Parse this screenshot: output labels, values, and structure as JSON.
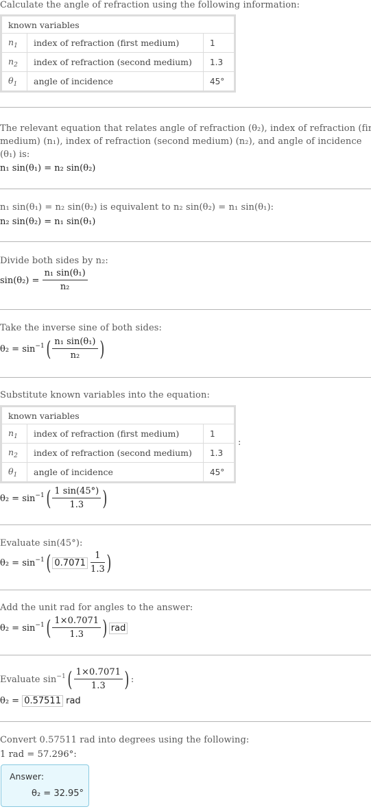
{
  "intro": "Calculate the angle of refraction using the following information:",
  "known_variables": {
    "header": "known variables",
    "rows": [
      {
        "symbol": "n",
        "sub": "1",
        "description": "index of refraction (first medium)",
        "value": "1"
      },
      {
        "symbol": "n",
        "sub": "2",
        "description": "index of refraction (second medium)",
        "value": "1.3"
      },
      {
        "symbol": "θ",
        "sub": "1",
        "description": "angle of incidence",
        "value": "45°"
      }
    ]
  },
  "steps": {
    "relevant": {
      "text_1": "The relevant equation that relates angle of refraction (θ₂), index of refraction (first",
      "text_2": "medium) (n₁), index of refraction (second medium) (n₂), and angle of incidence",
      "text_3": "(θ₁) is:",
      "equation": "n₁ sin(θ₁) = n₂ sin(θ₂)"
    },
    "equivalent": {
      "text": "n₁ sin(θ₁) = n₂ sin(θ₂) is equivalent to n₂ sin(θ₂) = n₁ sin(θ₁):",
      "equation": "n₂ sin(θ₂) = n₁ sin(θ₁)"
    },
    "divide": {
      "text": "Divide both sides by n₂:",
      "lhs": "sin(θ₂) =",
      "numerator": "n₁ sin(θ₁)",
      "denominator": "n₂"
    },
    "inverse": {
      "text": "Take the inverse sine of both sides:",
      "lhs": "θ₂ = sin",
      "sup": "−1",
      "numerator": "n₁ sin(θ₁)",
      "denominator": "n₂"
    },
    "substitute": {
      "text": "Substitute known variables into the equation:",
      "colon": ":",
      "lhs": "θ₂ = sin",
      "sup": "−1",
      "numerator": "1 sin(45°)",
      "denominator": "1.3"
    },
    "evaluate_sin": {
      "text": "Evaluate sin(45°):",
      "lhs": "θ₂ = sin",
      "sup": "−1",
      "boxed": "0.7071",
      "numerator": "1",
      "denominator": "1.3"
    },
    "add_unit": {
      "text": "Add the unit rad for angles to the answer:",
      "lhs": "θ₂ = sin",
      "sup": "−1",
      "numerator": "1×0.7071",
      "denominator": "1.3",
      "unit_boxed": "rad"
    },
    "evaluate_asin": {
      "text_prefix": "Evaluate sin",
      "sup": "−1",
      "numerator": "1×0.7071",
      "denominator": "1.3",
      "text_suffix": ":",
      "lhs": "θ₂ =",
      "boxed": "0.57511",
      "unit": "rad"
    },
    "convert": {
      "text": "Convert 0.57511 rad into degrees using the following:",
      "relation": "1 rad = 57.296°:"
    }
  },
  "answer": {
    "label": "Answer:",
    "equation": "θ₂ = 32.95°"
  },
  "colors": {
    "answer_bg": "#e8f8fd",
    "answer_border": "#88c9e0",
    "divider": "#b5b5b5",
    "table_border": "#dcdcdc"
  }
}
